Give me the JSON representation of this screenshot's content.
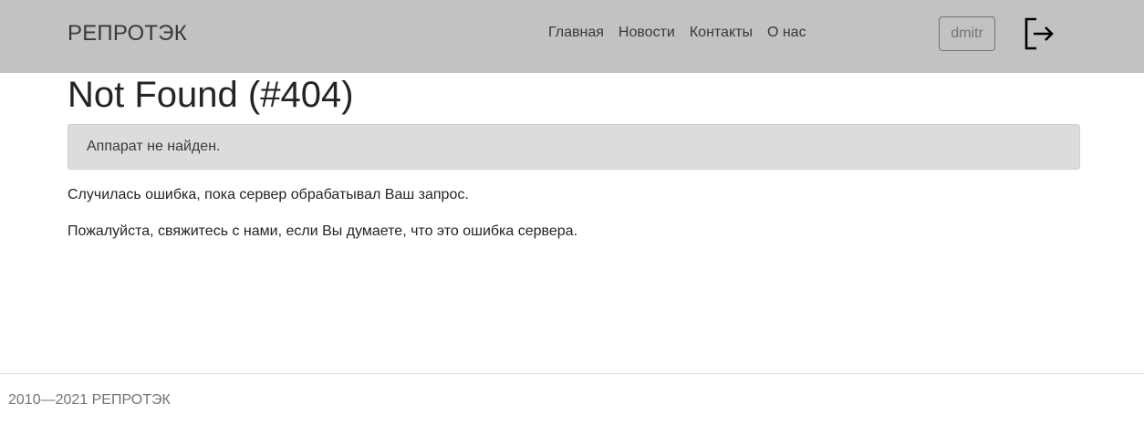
{
  "navbar": {
    "brand": "РЕПРОТЭК",
    "links": [
      "Главная",
      "Новости",
      "Контакты",
      "О нас"
    ],
    "user_label": "dmitr",
    "logout_icon": "logout-icon"
  },
  "main": {
    "title": "Not Found (#404)",
    "alert": "Аппарат не найден.",
    "paragraphs": [
      "Случилась ошибка, пока сервер обрабатывал Ваш запрос.",
      "Пожалуйста, свяжитесь с нами, если Вы думаете, что это ошибка сервера."
    ]
  },
  "footer": {
    "text": "2010—2021 РЕПРОТЭК"
  },
  "colors": {
    "navbar_bg": "#c2c2c2",
    "alert_bg": "#dcdcdc"
  }
}
